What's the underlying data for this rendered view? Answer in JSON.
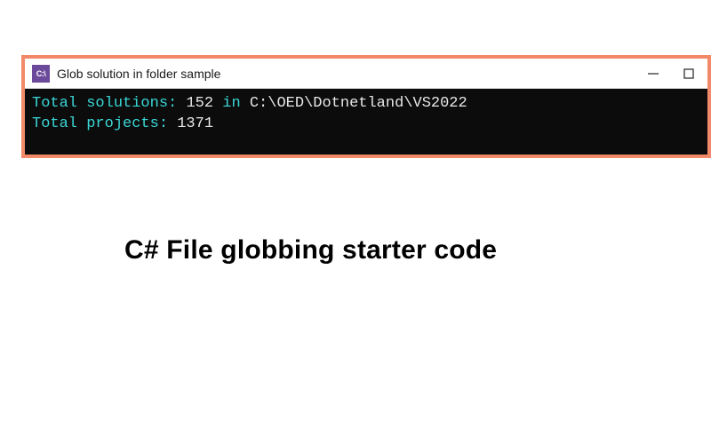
{
  "window": {
    "icon_text": "C:\\",
    "title": "Glob solution in folder sample"
  },
  "console": {
    "line1": {
      "label": "Total solutions: ",
      "count": "152",
      "in_word": " in ",
      "path": "C:\\OED\\Dotnetland\\VS2022"
    },
    "line2": {
      "label": "Total projects: ",
      "count": "1371"
    }
  },
  "caption": "C# File globbing starter code"
}
